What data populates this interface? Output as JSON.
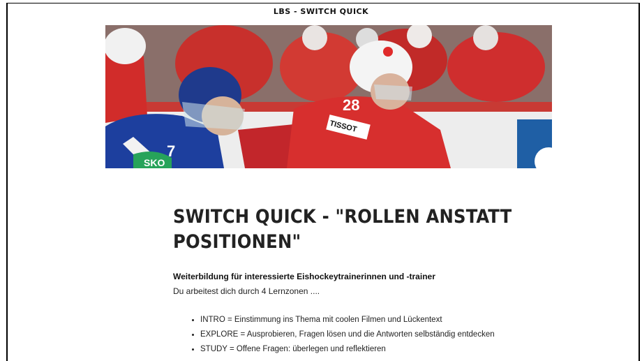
{
  "header": {
    "site_title": "LBS - SWITCH QUICK"
  },
  "hero": {
    "jersey_number": "28",
    "sponsor_text": "TISSOT"
  },
  "content": {
    "title": "SWITCH QUICK  - \"ROLLEN ANSTATT POSITIONEN\"",
    "subtitle": "Weiterbildung für interessierte Eishockeytrainerinnen und -trainer",
    "intro": "Du arbeitest dich durch 4 Lernzonen ....",
    "zones": [
      "INTRO = Einstimmung ins Thema mit coolen Filmen und Lückentext",
      "EXPLORE = Ausprobieren, Fragen lösen und die Antworten selbständig entdecken",
      "STUDY = Offene Fragen: überlegen und reflektieren"
    ]
  }
}
